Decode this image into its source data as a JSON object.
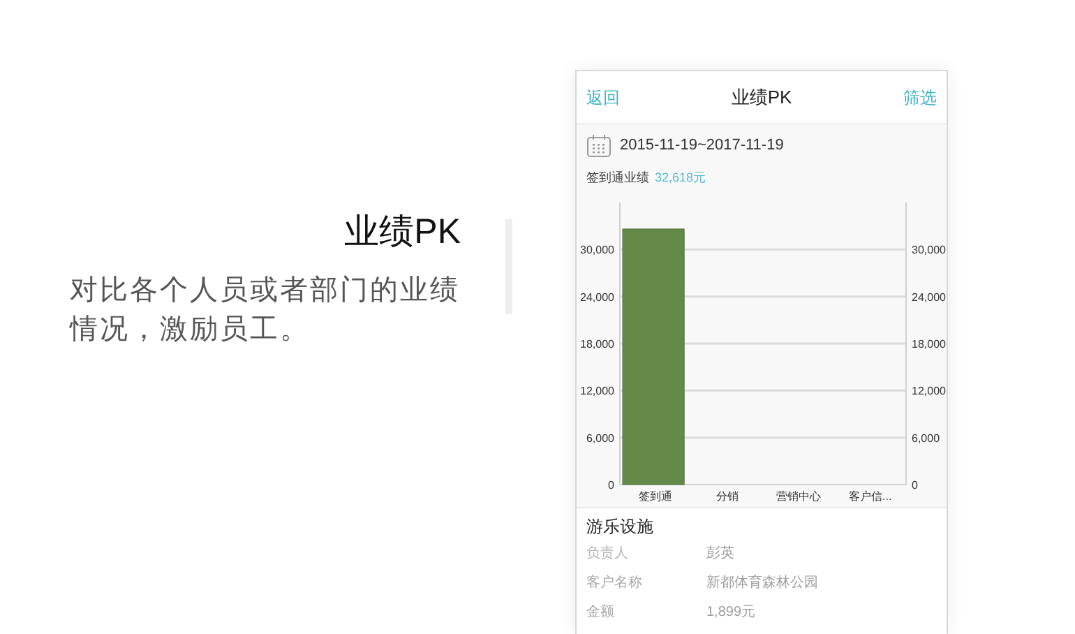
{
  "intro": {
    "title": "业绩PK",
    "description": "对比各个人员或者部门的业绩情况，激励员工。"
  },
  "phone": {
    "nav": {
      "back": "返回",
      "title": "业绩PK",
      "filter": "筛选"
    },
    "date_range": "2015-11-19~2017-11-19",
    "summary": {
      "label": "签到通业绩",
      "value": "32,618元"
    },
    "chart_data": {
      "type": "bar",
      "categories": [
        "签到通",
        "分销",
        "营销中心",
        "客户信..."
      ],
      "values": [
        32618,
        0,
        0,
        0
      ],
      "grid": true,
      "ylim": [
        0,
        36000
      ],
      "yticks": [
        {
          "value": 0,
          "label": "0"
        },
        {
          "value": 6000,
          "label": "6,000"
        },
        {
          "value": 12000,
          "label": "12,000"
        },
        {
          "value": 18000,
          "label": "18,000"
        },
        {
          "value": 24000,
          "label": "24,000"
        },
        {
          "value": 30000,
          "label": "30,000"
        }
      ]
    },
    "detail": {
      "title": "游乐设施",
      "rows": [
        {
          "label": "负责人",
          "value": "彭英"
        },
        {
          "label": "客户名称",
          "value": "新都体育森林公园"
        },
        {
          "label": "金额",
          "value": "1,899元"
        }
      ]
    }
  }
}
